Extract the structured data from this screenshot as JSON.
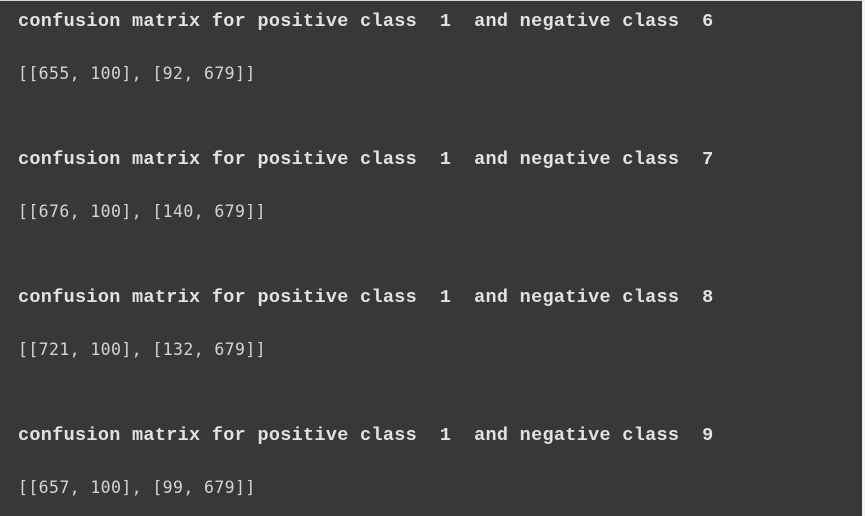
{
  "output": {
    "blocks": [
      {
        "header": "confusion matrix for positive class  1  and negative class  6",
        "positive_class": 1,
        "negative_class": 6,
        "matrix_text": "[[655, 100], [92, 679]]",
        "matrix": [
          [
            655,
            100
          ],
          [
            92,
            679
          ]
        ]
      },
      {
        "header": "confusion matrix for positive class  1  and negative class  7",
        "positive_class": 1,
        "negative_class": 7,
        "matrix_text": "[[676, 100], [140, 679]]",
        "matrix": [
          [
            676,
            100
          ],
          [
            140,
            679
          ]
        ]
      },
      {
        "header": "confusion matrix for positive class  1  and negative class  8",
        "positive_class": 1,
        "negative_class": 8,
        "matrix_text": "[[721, 100], [132, 679]]",
        "matrix": [
          [
            721,
            100
          ],
          [
            132,
            679
          ]
        ]
      },
      {
        "header": "confusion matrix for positive class  1  and negative class  9",
        "positive_class": 1,
        "negative_class": 9,
        "matrix_text": "[[657, 100], [99, 679]]",
        "matrix": [
          [
            657,
            100
          ],
          [
            99,
            679
          ]
        ]
      }
    ]
  },
  "colors": {
    "background": "#383838",
    "header_text": "#e2e2e2",
    "matrix_text": "#d4d4d4"
  }
}
